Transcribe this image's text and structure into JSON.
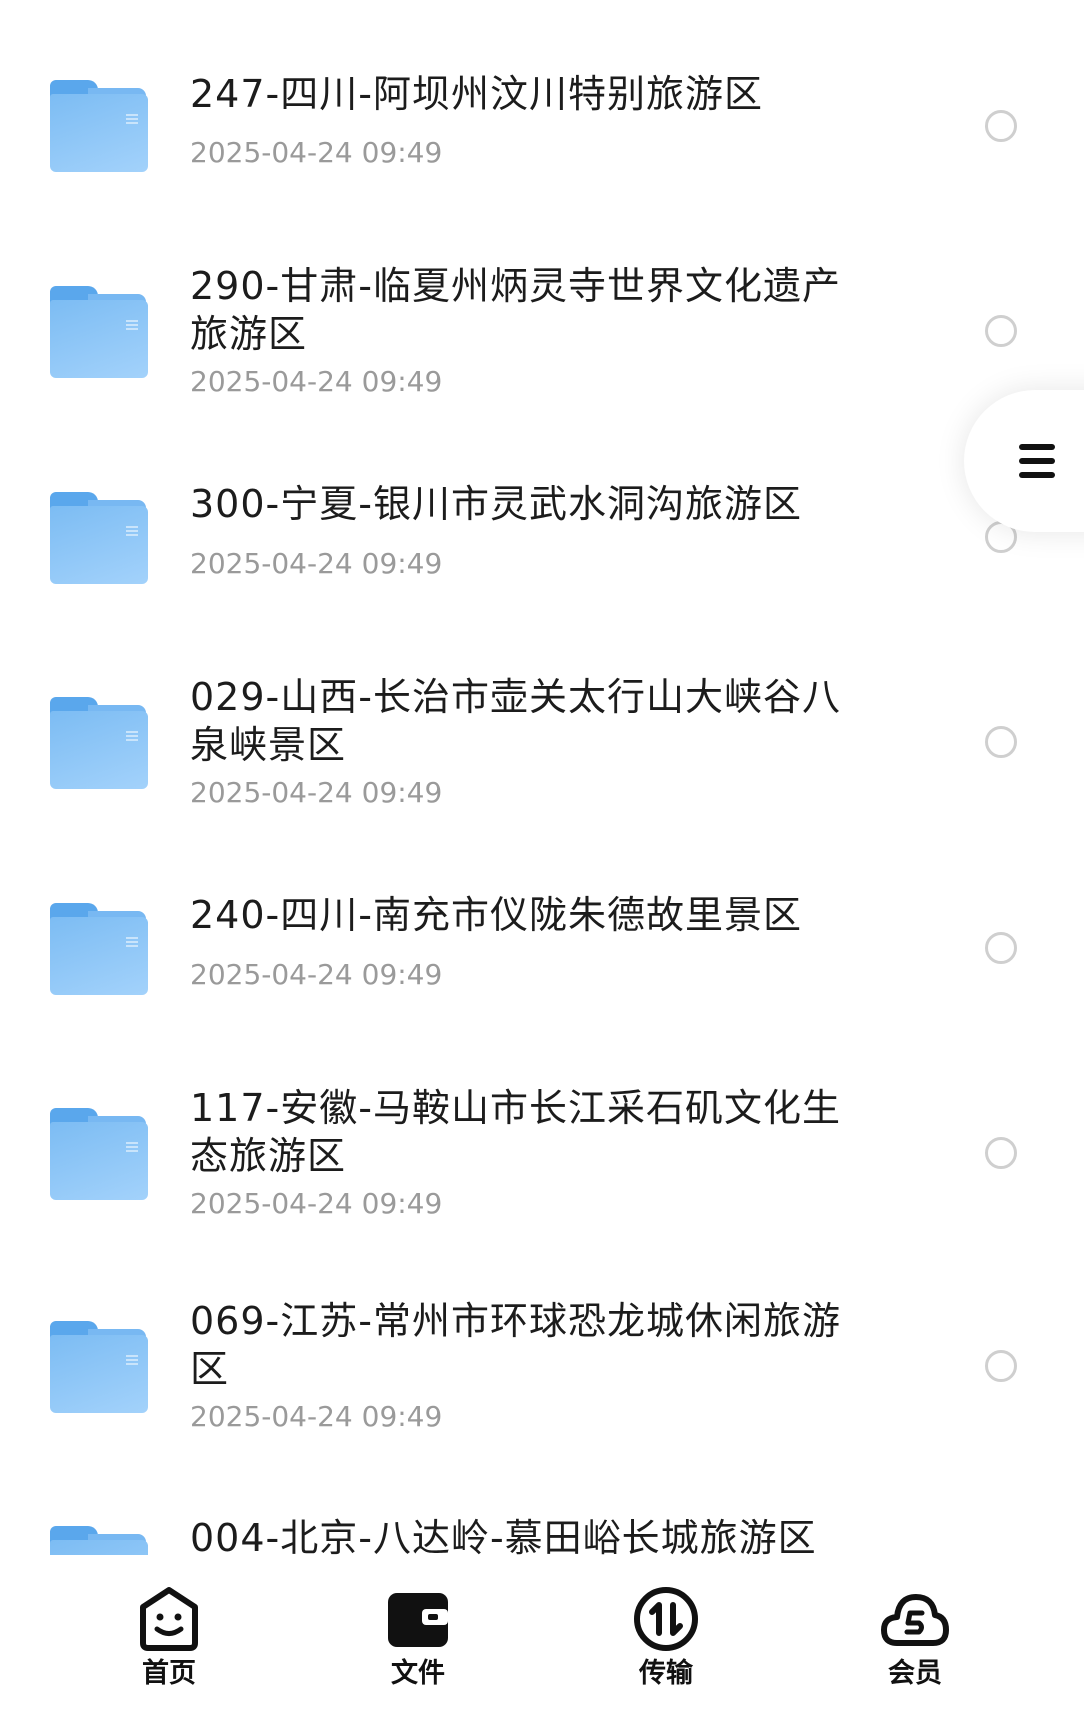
{
  "files": [
    {
      "name": "247-四川-阿坝州汶川特别旅游区",
      "date": "2025-04-24 09:49"
    },
    {
      "name": "290-甘肃-临夏州炳灵寺世界文化遗产旅游区",
      "date": "2025-04-24 09:49"
    },
    {
      "name": "300-宁夏-银川市灵武水洞沟旅游区",
      "date": "2025-04-24 09:49"
    },
    {
      "name": "029-山西-长治市壶关太行山大峡谷八泉峡景区",
      "date": "2025-04-24 09:49"
    },
    {
      "name": "240-四川-南充市仪陇朱德故里景区",
      "date": "2025-04-24 09:49"
    },
    {
      "name": "117-安徽-马鞍山市长江采石矶文化生态旅游区",
      "date": "2025-04-24 09:49"
    },
    {
      "name": "069-江苏-常州市环球恐龙城休闲旅游区",
      "date": "2025-04-24 09:49"
    },
    {
      "name": "004-北京-八达岭-慕田峪长城旅游区",
      "date": ""
    }
  ],
  "tabbar": {
    "home": "首页",
    "files": "文件",
    "transfer": "传输",
    "member": "会员"
  },
  "colors": {
    "folder": "#7cbcf3",
    "title": "#1c1c1c",
    "date": "#9a9a9a",
    "radio": "#cfcfcf"
  },
  "icons": [
    "folder-icon",
    "menu-icon",
    "home-smile-icon",
    "wallet-icon",
    "transfer-icon",
    "cloud-s-icon"
  ]
}
